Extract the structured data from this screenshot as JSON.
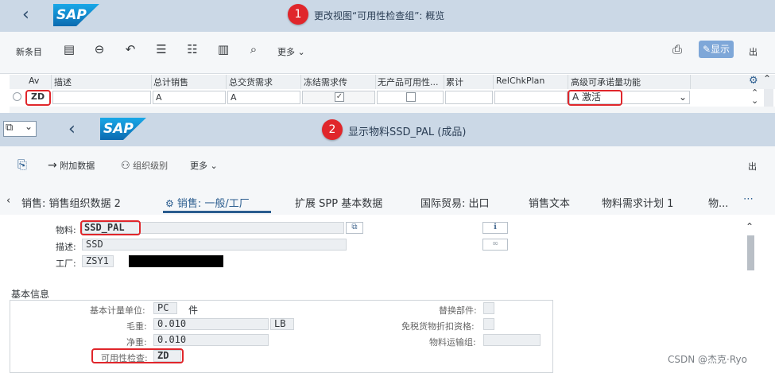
{
  "window1": {
    "title": "更改视图“可用性检查组”: 概览",
    "logo": "SAP",
    "badge": "1",
    "toolbar": {
      "new_entries": "新条目",
      "more": "更多",
      "display": "显示",
      "exit": "出"
    },
    "table": {
      "headers": [
        "Av",
        "描述",
        "总计销售",
        "总交货需求",
        "冻结需求传",
        "无产品可用性...",
        "累计",
        "RelChkPlan",
        "高级可承诺量功能"
      ],
      "row": {
        "av": "ZD",
        "desc": "",
        "total_sales": "A",
        "total_delivery": "A",
        "block_checked": true,
        "no_product_checked": false,
        "cumulative": "",
        "relchkplan": "",
        "aatp": "A 激活"
      }
    }
  },
  "window2": {
    "title": "显示物料SSD_PAL (成品)",
    "logo": "SAP",
    "badge": "2",
    "toolbar": {
      "additional_data": "附加数据",
      "org_levels": "组织级别",
      "more": "更多",
      "exit": "出"
    },
    "tabs": [
      "销售: 销售组织数据 2",
      "销售: 一般/工厂",
      "扩展 SPP 基本数据",
      "国际贸易: 出口",
      "销售文本",
      "物料需求计划 1",
      "物..."
    ],
    "active_tab": 1,
    "header_fields": {
      "material_label": "物料:",
      "material_value": "SSD_PAL",
      "desc_label": "描述:",
      "desc_value": "SSD",
      "plant_label": "工厂:",
      "plant_value": "ZSY1"
    },
    "basic_info": {
      "title": "基本信息",
      "base_uom_label": "基本计量单位:",
      "base_uom_value": "PC",
      "base_uom_text": "件",
      "gross_weight_label": "毛重:",
      "gross_weight_value": "0.010",
      "weight_unit": "LB",
      "net_weight_label": "净重:",
      "net_weight_value": "0.010",
      "availability_check_label": "可用性检查:",
      "availability_check_value": "ZD",
      "replacement_part_label": "替换部件:",
      "tax_free_label": "免税货物折扣资格:",
      "material_freight_group_label": "物料运输组:"
    }
  },
  "watermark": "CSDN @杰克·Ryo",
  "colors": {
    "title_bar": "#cbd8e6",
    "highlight": "#e0262b",
    "accent": "#2b5d8f",
    "sap_blue": "#1a8fd6"
  }
}
